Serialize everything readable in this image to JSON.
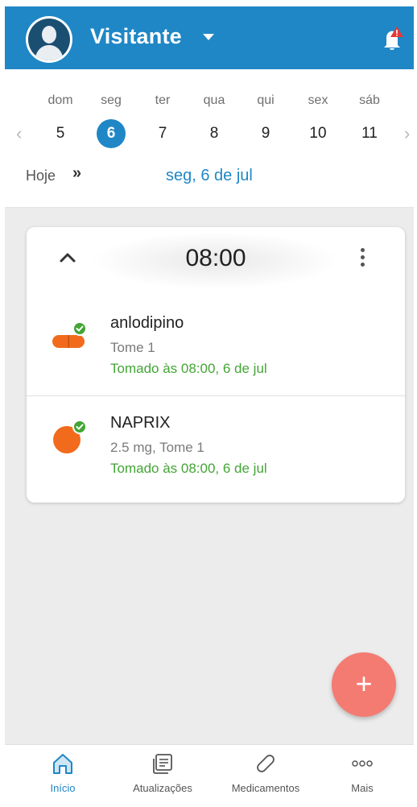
{
  "header": {
    "user_name": "Visitante"
  },
  "calendar": {
    "days": [
      {
        "name": "dom",
        "num": "5"
      },
      {
        "name": "seg",
        "num": "6"
      },
      {
        "name": "ter",
        "num": "7"
      },
      {
        "name": "qua",
        "num": "8"
      },
      {
        "name": "qui",
        "num": "9"
      },
      {
        "name": "sex",
        "num": "10"
      },
      {
        "name": "sáb",
        "num": "11"
      }
    ],
    "selected_index": 1,
    "today_label": "Hoje",
    "selected_date": "seg, 6 de jul"
  },
  "dose_group": {
    "time": "08:00",
    "medications": [
      {
        "name": "anlodipino",
        "dose": "Tome 1",
        "status": "Tomado às 08:00, 6 de jul",
        "pill_icon": "capsule-icon"
      },
      {
        "name": "NAPRIX",
        "dose": "2.5 mg, Tome 1",
        "status": "Tomado às 08:00, 6 de jul",
        "pill_icon": "round-pill-icon"
      }
    ]
  },
  "fab": {
    "label": "+"
  },
  "bottom_nav": {
    "items": [
      {
        "label": "Início",
        "icon": "home-icon",
        "active": true
      },
      {
        "label": "Atualizações",
        "icon": "news-icon",
        "active": false
      },
      {
        "label": "Medicamentos",
        "icon": "pill-icon",
        "active": false
      },
      {
        "label": "Mais",
        "icon": "more-icon",
        "active": false
      }
    ]
  },
  "colors": {
    "primary": "#1f87c6",
    "taken": "#43a535",
    "pill": "#f26b1d",
    "fab": "#f47b72",
    "alert": "#e53935"
  }
}
